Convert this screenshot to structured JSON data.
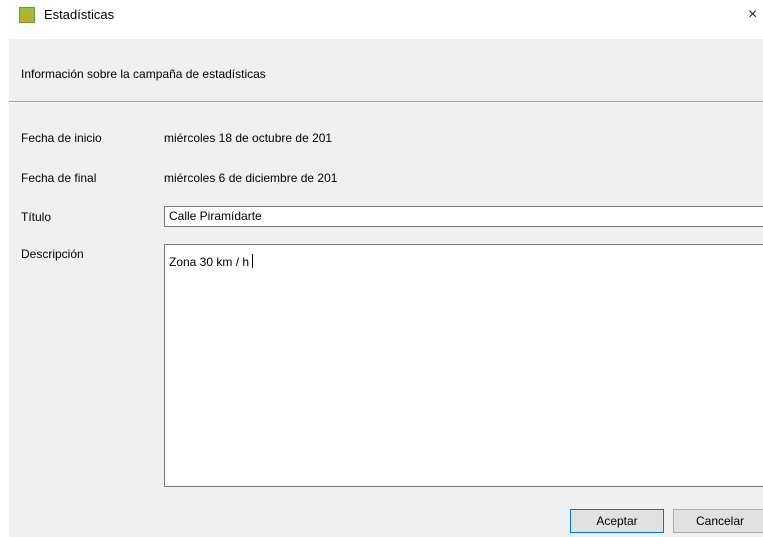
{
  "window": {
    "title": "Estadísticas",
    "close_glyph": "×",
    "app_icon": "app-logo-icon"
  },
  "header": {
    "info": "Información sobre la campaña de estadísticas"
  },
  "fields": {
    "start_label": "Fecha de inicio",
    "start_value": "miércoles 18 de octubre de 201",
    "end_label": "Fecha de final",
    "end_value": "miércoles 6 de diciembre de 201",
    "title_label": "Título",
    "title_value": "Calle Piramídarte",
    "desc_label": "Descripción",
    "desc_value": "Zona 30 km / h"
  },
  "buttons": {
    "accept": "Aceptar",
    "cancel": "Cancelar"
  },
  "colors": {
    "dialog_bg": "#f0f0f0",
    "default_button_border": "#0078d7",
    "icon_green": "#8cc43c"
  }
}
